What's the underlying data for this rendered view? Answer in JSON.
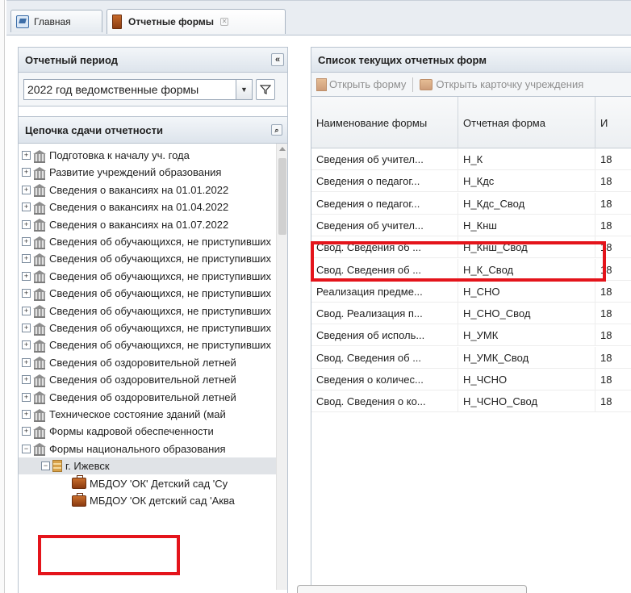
{
  "tabs": [
    {
      "label": "Главная",
      "icon": "home-icon"
    },
    {
      "label": "Отчетные формы",
      "icon": "form-icon",
      "active": true
    }
  ],
  "left": {
    "period_title": "Отчетный период",
    "period_value": "2022 год ведомственные формы",
    "chain_title": "Цепочка сдачи отчетности",
    "tree": [
      {
        "label": "Подготовка к началу уч. года",
        "level": 0,
        "expander": "+",
        "icon": "bank"
      },
      {
        "label": "Развитие учреждений образования",
        "level": 0,
        "expander": "+",
        "icon": "bank"
      },
      {
        "label": "Сведения о вакансиях на 01.01.2022",
        "level": 0,
        "expander": "+",
        "icon": "bank"
      },
      {
        "label": "Сведения о вакансиях на 01.04.2022",
        "level": 0,
        "expander": "+",
        "icon": "bank"
      },
      {
        "label": "Сведения о вакансиях на 01.07.2022",
        "level": 0,
        "expander": "+",
        "icon": "bank"
      },
      {
        "label": "Сведения об обучающихся, не приступивших",
        "level": 0,
        "expander": "+",
        "icon": "bank"
      },
      {
        "label": "Сведения об обучающихся, не приступивших",
        "level": 0,
        "expander": "+",
        "icon": "bank"
      },
      {
        "label": "Сведения об обучающихся, не приступивших",
        "level": 0,
        "expander": "+",
        "icon": "bank"
      },
      {
        "label": "Сведения об обучающихся, не приступивших",
        "level": 0,
        "expander": "+",
        "icon": "bank"
      },
      {
        "label": "Сведения об обучающихся, не приступивших",
        "level": 0,
        "expander": "+",
        "icon": "bank"
      },
      {
        "label": "Сведения об обучающихся, не приступивших",
        "level": 0,
        "expander": "+",
        "icon": "bank"
      },
      {
        "label": "Сведения об обучающихся, не приступивших",
        "level": 0,
        "expander": "+",
        "icon": "bank"
      },
      {
        "label": "Сведения об оздоровительной летней",
        "level": 0,
        "expander": "+",
        "icon": "bank"
      },
      {
        "label": "Сведения об оздоровительной летней",
        "level": 0,
        "expander": "+",
        "icon": "bank"
      },
      {
        "label": "Сведения об оздоровительной летней",
        "level": 0,
        "expander": "+",
        "icon": "bank"
      },
      {
        "label": "Техническое состояние зданий (май",
        "level": 0,
        "expander": "+",
        "icon": "bank"
      },
      {
        "label": "Формы кадровой обеспеченности",
        "level": 0,
        "expander": "+",
        "icon": "bank"
      },
      {
        "label": "Формы национального образования",
        "level": 0,
        "expander": "−",
        "icon": "bank"
      },
      {
        "label": "г. Ижевск",
        "level": 1,
        "expander": "−",
        "icon": "building",
        "selected": true
      },
      {
        "label": "МБДОУ 'ОК' Детский сад 'Су",
        "level": 2,
        "expander": "",
        "icon": "briefcase"
      },
      {
        "label": "МБДОУ 'ОК детский сад 'Аква",
        "level": 2,
        "expander": "",
        "icon": "briefcase"
      }
    ]
  },
  "right": {
    "title": "Список текущих отчетных форм",
    "toolbar": {
      "open_form": "Открыть форму",
      "open_card": "Открыть карточку учреждения"
    },
    "columns": [
      "Наименование формы",
      "Отчетная форма",
      "И"
    ],
    "rows": [
      {
        "name": "Сведения об учител...",
        "form": "Н_К",
        "extra": "18"
      },
      {
        "name": "Сведения о педагог...",
        "form": "Н_Кдс",
        "extra": "18"
      },
      {
        "name": "Сведения о педагог...",
        "form": "Н_Кдс_Свод",
        "extra": "18"
      },
      {
        "name": "Сведения об учител...",
        "form": "Н_Кнш",
        "extra": "18"
      },
      {
        "name": "Свод. Сведения об ...",
        "form": "Н_Кнш_Свод",
        "extra": "18"
      },
      {
        "name": "Свод. Сведения об ...",
        "form": "Н_К_Свод",
        "extra": "18"
      },
      {
        "name": "Реализация предме...",
        "form": "Н_СНО",
        "extra": "18"
      },
      {
        "name": "Свод. Реализация п...",
        "form": "Н_СНО_Свод",
        "extra": "18"
      },
      {
        "name": "Сведения об исполь...",
        "form": "Н_УМК",
        "extra": "18"
      },
      {
        "name": "Свод. Сведения об ...",
        "form": "Н_УМК_Свод",
        "extra": "18"
      },
      {
        "name": "Сведения о количес...",
        "form": "Н_ЧСНО",
        "extra": "18"
      },
      {
        "name": "Свод. Сведения о ко...",
        "form": "Н_ЧСНО_Свод",
        "extra": "18"
      }
    ]
  },
  "colors": {
    "highlight": "#e4141b",
    "header_bg": "#dde4ec",
    "selection": "#e0e3e7"
  }
}
